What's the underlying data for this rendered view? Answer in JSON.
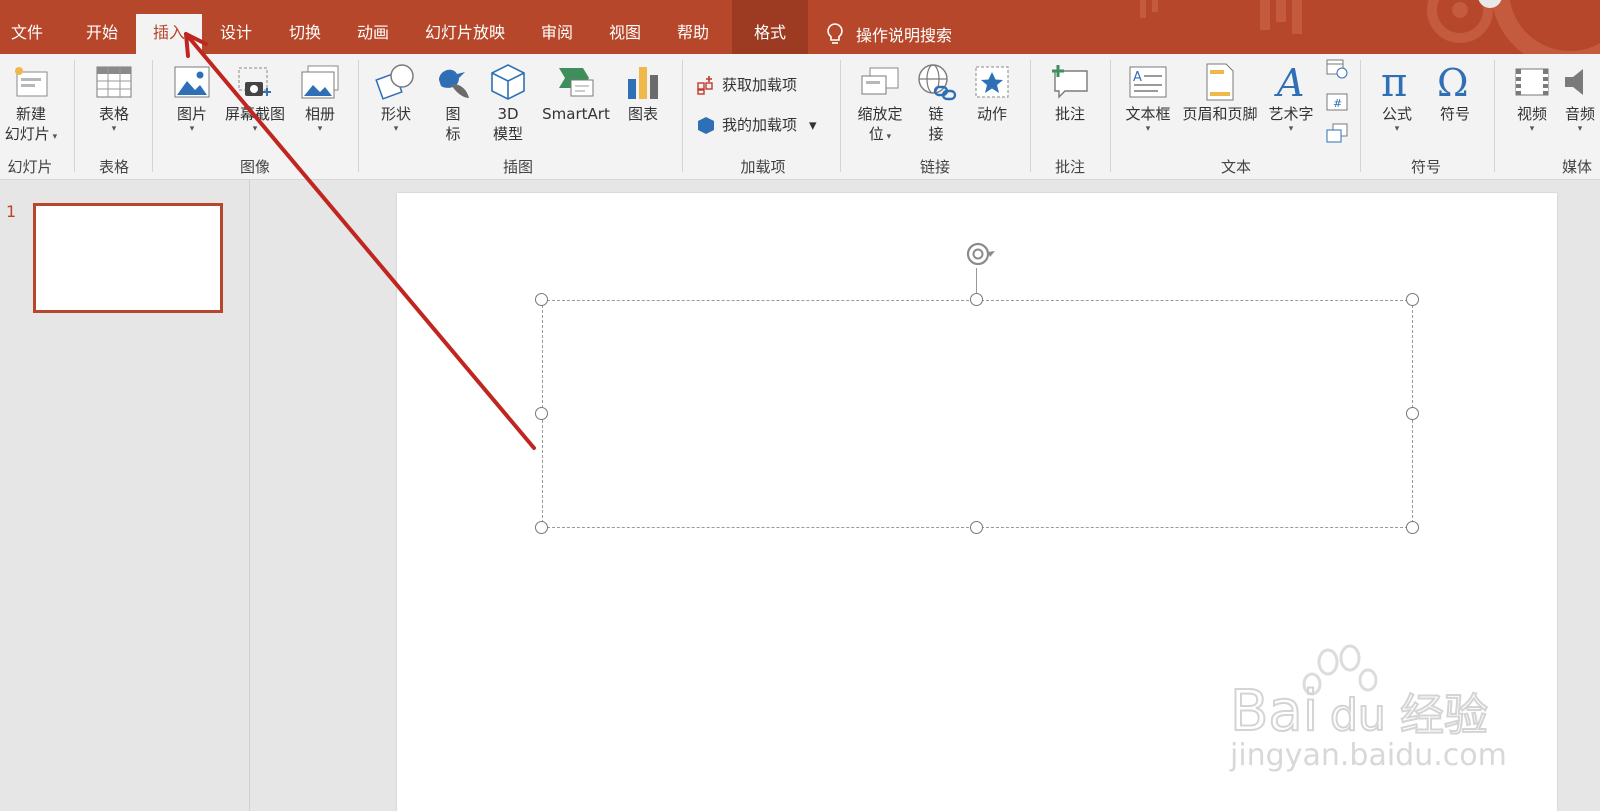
{
  "menu": {
    "tabs": [
      "文件",
      "开始",
      "插入",
      "设计",
      "切换",
      "动画",
      "幻灯片放映",
      "审阅",
      "视图",
      "帮助",
      "格式"
    ],
    "active": "插入",
    "search": "操作说明搜索"
  },
  "ribbon": {
    "new_slide_line1": "新建",
    "new_slide_line2": "幻灯片",
    "table": "表格",
    "picture": "图片",
    "screenshot": "屏幕截图",
    "album": "相册",
    "shapes": "形状",
    "icons_line1": "图",
    "icons_line2": "标",
    "model3d_line1": "3D",
    "model3d_line2": "模型",
    "smartart": "SmartArt",
    "chart": "图表",
    "get_addins": "获取加载项",
    "my_addins": "我的加载项",
    "zoom_line1": "缩放定",
    "zoom_line2": "位",
    "link_line1": "链",
    "link_line2": "接",
    "action": "动作",
    "comment": "批注",
    "textbox": "文本框",
    "header_footer": "页眉和页脚",
    "wordart": "艺术字",
    "equation": "公式",
    "symbol": "符号",
    "video": "视频",
    "audio": "音频",
    "groups": {
      "slides": "幻灯片",
      "tables": "表格",
      "images": "图像",
      "illustrations": "插图",
      "addins": "加载项",
      "links": "链接",
      "comments": "批注",
      "text": "文本",
      "symbols": "符号",
      "media": "媒体"
    }
  },
  "thumbnails": [
    {
      "number": "1"
    }
  ],
  "watermark": {
    "brand": "Bai",
    "brand2": "du",
    "cn": "经验",
    "url": "jingyan.baidu.com"
  },
  "colors": {
    "accent": "#b7472a",
    "arrow": "#c0261f"
  }
}
